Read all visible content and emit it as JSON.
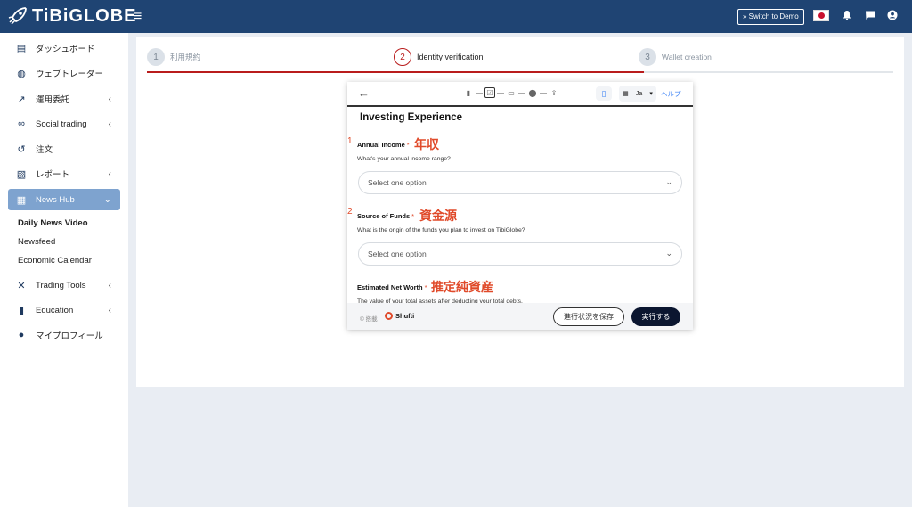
{
  "header": {
    "logo_text": "TiBiGLOBE",
    "menu_icon": "hamburger-icon",
    "switch_demo_label": "» Switch to Demo",
    "icons": [
      "flag-japan-icon",
      "bell-icon",
      "chat-icon",
      "user-icon"
    ]
  },
  "sidebar": {
    "items": [
      {
        "label": "ダッシュボード",
        "icon": "id-card-icon",
        "chevron": ""
      },
      {
        "label": "ウェブトレーダー",
        "icon": "globe-icon",
        "chevron": ""
      },
      {
        "label": "運用委託",
        "icon": "chart-line-icon",
        "chevron": "‹"
      },
      {
        "label": "Social trading",
        "icon": "link-icon",
        "chevron": "‹"
      },
      {
        "label": "注文",
        "icon": "history-icon",
        "chevron": ""
      },
      {
        "label": "レポート",
        "icon": "report-icon",
        "chevron": "‹"
      },
      {
        "label": "News Hub",
        "icon": "newspaper-icon",
        "chevron": "⌄"
      },
      {
        "label": "Trading Tools",
        "icon": "tools-icon",
        "chevron": "‹"
      },
      {
        "label": "Education",
        "icon": "book-icon",
        "chevron": "‹"
      },
      {
        "label": "マイプロフィール",
        "icon": "user-icon",
        "chevron": ""
      }
    ],
    "subitems": [
      "Daily News Video",
      "Newsfeed",
      "Economic Calendar"
    ]
  },
  "steps": [
    {
      "num": "1",
      "label": "利用規約"
    },
    {
      "num": "2",
      "label": "Identity verification"
    },
    {
      "num": "3",
      "label": "Wallet creation"
    }
  ],
  "widget": {
    "back": "←",
    "language": "Ja",
    "help": "ヘルプ",
    "title": "Investing Experience",
    "questions": [
      {
        "num": "1",
        "label": "Annual Income",
        "req": "*",
        "jp": "年収",
        "desc": "What's your annual income range?",
        "placeholder": "Select one option"
      },
      {
        "num": "2",
        "label": "Source of Funds",
        "req": "*",
        "jp": "資金源",
        "desc": "What is the origin of the funds you plan to invest on TibiGlobe?",
        "placeholder": "Select one option"
      },
      {
        "num": "",
        "label": "Estimated Net Worth",
        "req": "*",
        "jp": "推定純資産",
        "desc": "The value of your total assets after deducting your total debts.",
        "placeholder": ""
      }
    ],
    "powered_by": "© 搭載",
    "brand": "Shufti",
    "save_label": "進行状況を保存",
    "execute_label": "実行する"
  }
}
